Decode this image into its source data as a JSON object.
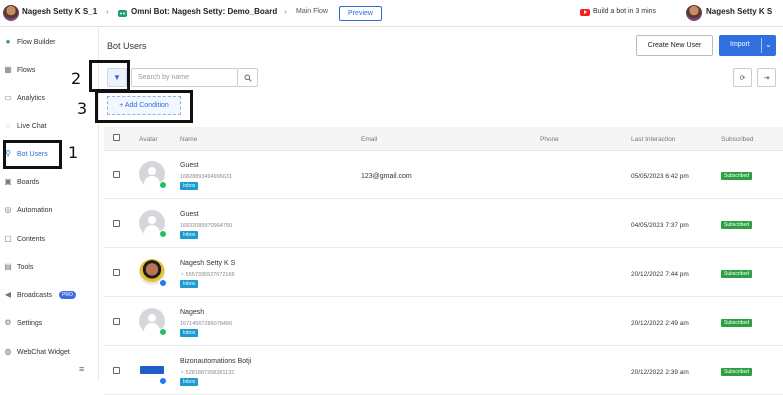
{
  "topbar": {
    "user_left": "Nagesh Setty K S_1",
    "bot_title": "Omni Bot: Nagesh Setty: Demo_Board",
    "flow_label": "Main Flow",
    "preview_label": "Preview",
    "promo_label": "Build a bot in 3 mins",
    "user_right": "Nagesh Setty K S"
  },
  "sidebar": {
    "items": [
      {
        "label": "Flow Builder",
        "icon": "flow-builder-icon"
      },
      {
        "label": "Flows",
        "icon": "flows-icon"
      },
      {
        "label": "Analytics",
        "icon": "analytics-icon"
      },
      {
        "label": "Live Chat",
        "icon": "live-chat-icon"
      },
      {
        "label": "Bot Users",
        "icon": "bot-users-icon"
      },
      {
        "label": "Boards",
        "icon": "boards-icon"
      },
      {
        "label": "Automation",
        "icon": "automation-icon"
      },
      {
        "label": "Contents",
        "icon": "contents-icon"
      },
      {
        "label": "Tools",
        "icon": "tools-icon"
      },
      {
        "label": "Broadcasts",
        "icon": "broadcasts-icon",
        "badge": "PRO"
      },
      {
        "label": "Settings",
        "icon": "settings-icon"
      },
      {
        "label": "WebChat Widget",
        "icon": "webchat-icon"
      }
    ],
    "active": "Bot Users"
  },
  "main": {
    "title": "Bot Users",
    "create_label": "Create New User",
    "import_label": "Import",
    "search_placeholder": "Search by name",
    "add_condition_label": "+ Add Condition",
    "annotations": [
      "1",
      "2",
      "3"
    ]
  },
  "table": {
    "columns": [
      "Avatar",
      "Name",
      "Email",
      "Phone",
      "Last Interaction",
      "Subscribed"
    ],
    "rows": [
      {
        "name": "Guest",
        "uid": "16828893494996631",
        "tag": "Inbox",
        "email": "123@gmail.com",
        "phone": "",
        "last": "05/05/2023 6:42 pm",
        "status": "Subscribed",
        "channel": "whatsapp"
      },
      {
        "name": "Guest",
        "uid": "16832089970964750",
        "tag": "Inbox",
        "email": "",
        "phone": "",
        "last": "04/05/2023 7:37 pm",
        "status": "Subscribed",
        "channel": "whatsapp"
      },
      {
        "name": "Nagesh Setty K S",
        "uid": "5557395527672169",
        "tag": "Inbox",
        "email": "",
        "phone": "",
        "last": "20/12/2022 7:44 pm",
        "status": "Subscribed",
        "channel": "messenger"
      },
      {
        "name": "Nagesh",
        "uid": "16714567286078490",
        "tag": "Inbox",
        "email": "",
        "phone": "",
        "last": "20/12/2022 2:49 am",
        "status": "Subscribed",
        "channel": "whatsapp"
      },
      {
        "name": "Bizonautomations Botji",
        "uid": "5281887268281132",
        "tag": "Inbox",
        "email": "",
        "phone": "",
        "last": "20/12/2022 2:39 am",
        "status": "Subscribed",
        "channel": "messenger"
      }
    ]
  }
}
